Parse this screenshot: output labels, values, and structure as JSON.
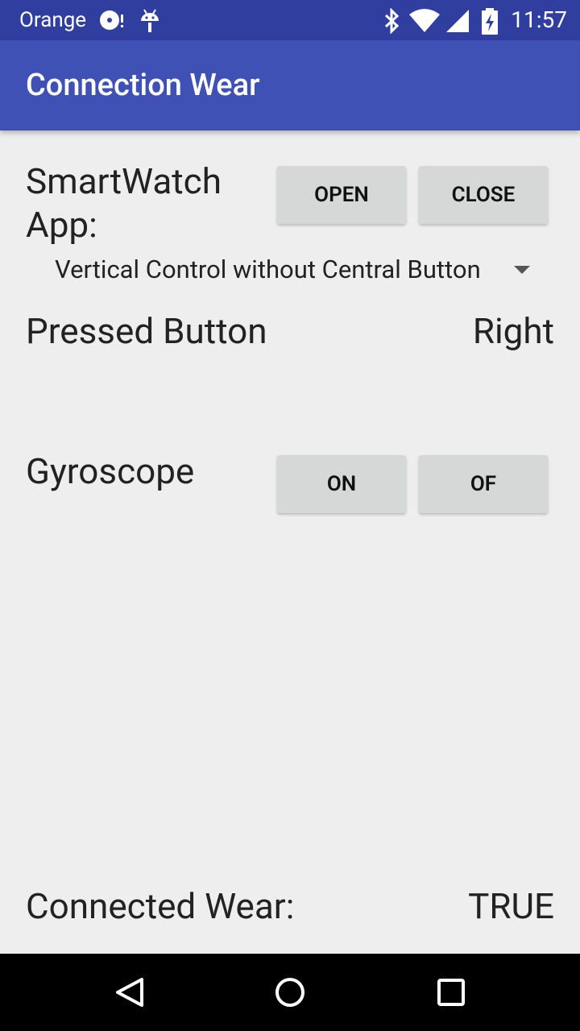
{
  "status_bar": {
    "carrier": "Orange",
    "time": "11:57",
    "icons": [
      "disc-icon",
      "android-icon",
      "bluetooth-icon",
      "wifi-icon",
      "signal-icon",
      "battery-charging-icon"
    ]
  },
  "app_bar": {
    "title": "Connection Wear"
  },
  "smartwatch": {
    "label": "SmartWatch App:",
    "open_label": "OPEN",
    "close_label": "CLOSE"
  },
  "spinner": {
    "selected": "Vertical Control without Central Button"
  },
  "pressed": {
    "label": "Pressed Button",
    "value": "Right"
  },
  "gyroscope": {
    "label": "Gyroscope",
    "on_label": "ON",
    "off_label": "OF"
  },
  "connected": {
    "label": "Connected Wear:",
    "value": "TRUE"
  },
  "nav_bar": {
    "icons": [
      "back-icon",
      "home-icon",
      "recents-icon"
    ]
  },
  "colors": {
    "status_bar": "#303f9f",
    "app_bar": "#3f51b5",
    "background": "#eeeeee",
    "button": "#d6d7d7"
  }
}
